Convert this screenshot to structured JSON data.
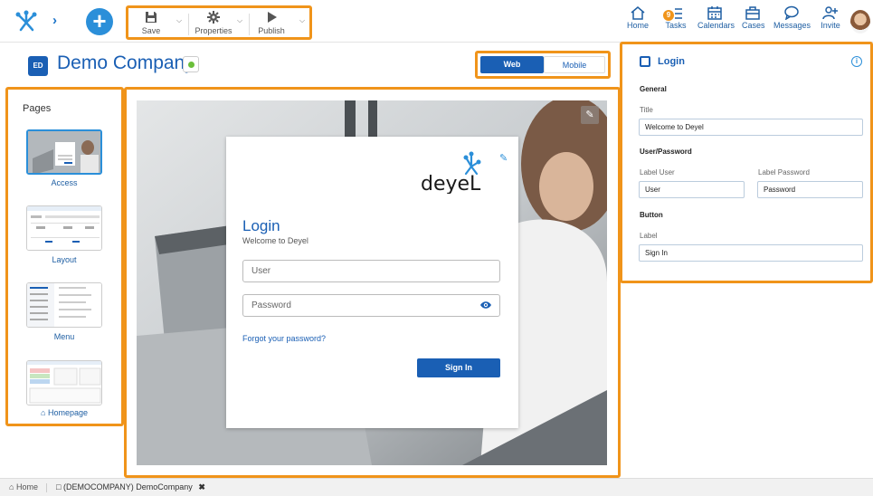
{
  "toolbar": {
    "save": "Save",
    "properties": "Properties",
    "publish": "Publish"
  },
  "nav": {
    "home": "Home",
    "tasks": "Tasks",
    "calendars": "Calendars",
    "cases": "Cases",
    "messages": "Messages",
    "invite": "Invite",
    "tasks_badge": "9"
  },
  "company": {
    "initials": "ED",
    "name": "Demo Company"
  },
  "view_toggle": {
    "web": "Web",
    "mobile": "Mobile"
  },
  "pages": {
    "title": "Pages",
    "items": [
      {
        "label": "Access"
      },
      {
        "label": "Layout"
      },
      {
        "label": "Menu"
      },
      {
        "label": "Homepage"
      }
    ]
  },
  "login_preview": {
    "logo_text": "deyeL",
    "title": "Login",
    "subtitle": "Welcome to Deyel",
    "user_placeholder": "User",
    "password_placeholder": "Password",
    "forgot": "Forgot your password?",
    "sign_in": "Sign In"
  },
  "properties_panel": {
    "title": "Login",
    "general": "General",
    "title_label": "Title",
    "title_value": "Welcome to Deyel",
    "user_password": "User/Password",
    "label_user": "Label User",
    "label_user_value": "User",
    "label_password": "Label Password",
    "label_password_value": "Password",
    "button": "Button",
    "label": "Label",
    "label_value": "Sign In"
  },
  "bottom_tabs": {
    "home": "Home",
    "doc": "(DEMOCOMPANY) DemoCompany"
  },
  "colors": {
    "accent": "#f0941a",
    "primary": "#1a5fb4",
    "button": "#2b8fd9"
  }
}
